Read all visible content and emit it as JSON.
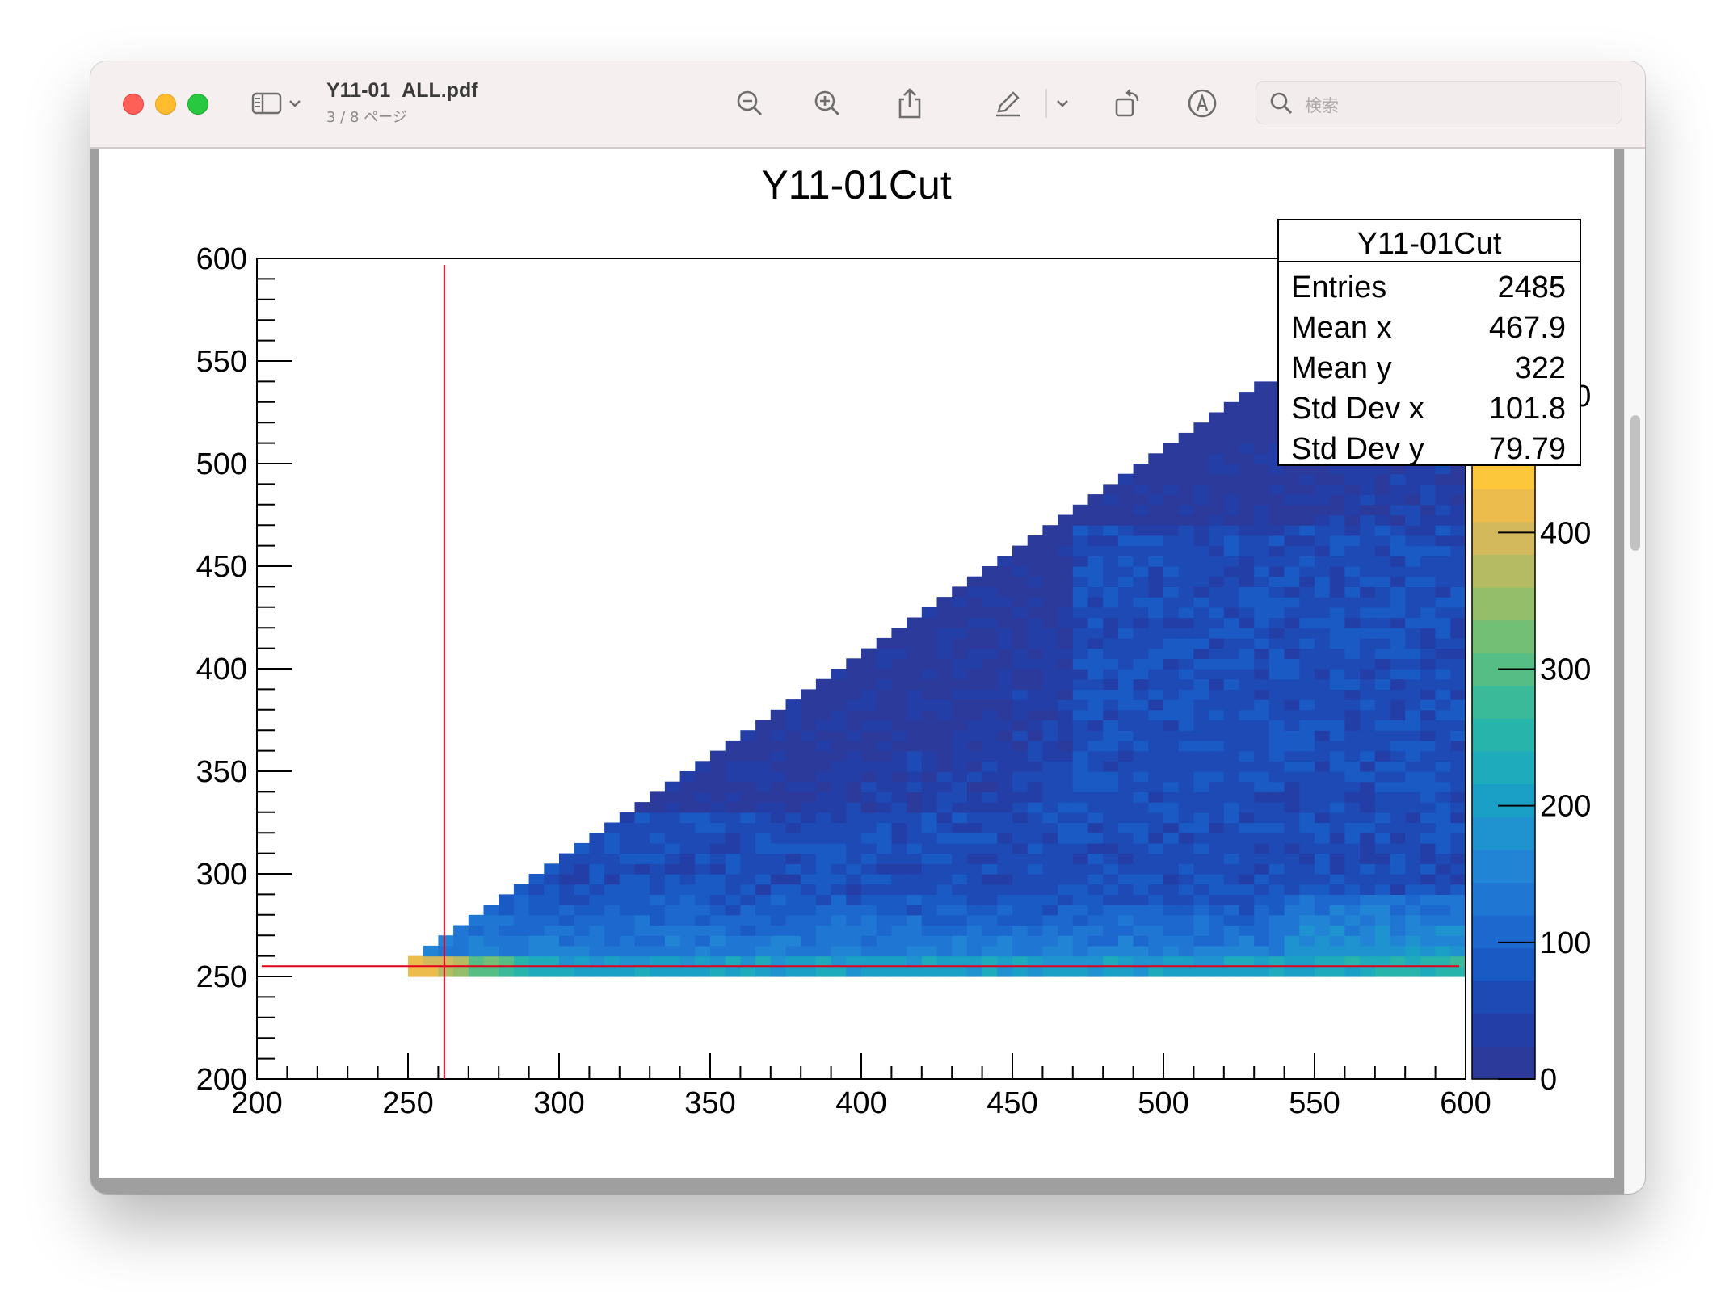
{
  "window": {
    "title": "Y11-01_ALL.pdf",
    "page_indicator": "3 / 8 ページ",
    "search_placeholder": "検索"
  },
  "toolbar": {
    "icons": [
      "sidebar-icon",
      "chevron-down-icon",
      "zoom-out-icon",
      "zoom-in-icon",
      "share-icon",
      "markup-pen-icon",
      "chevron-down-icon",
      "rotate-icon",
      "annotate-icon",
      "search-icon"
    ]
  },
  "chart_data": {
    "type": "heatmap",
    "title": "Y11-01Cut",
    "xlim": [
      200,
      600
    ],
    "ylim": [
      200,
      600
    ],
    "x_ticks": [
      200,
      250,
      300,
      350,
      400,
      450,
      500,
      550,
      600
    ],
    "y_ticks": [
      200,
      250,
      300,
      350,
      400,
      450,
      500,
      550,
      600
    ],
    "bin_width": 5,
    "z_range": [
      0,
      480
    ],
    "z_ticks": [
      0,
      100,
      200,
      300,
      400,
      500
    ],
    "z_tick_labels": [
      "0",
      "100",
      "200",
      "300",
      "400",
      "500"
    ],
    "palette": [
      "#2b3a9b",
      "#233fa7",
      "#1d4ab5",
      "#1a5ac5",
      "#1c68cf",
      "#2076d3",
      "#2284d4",
      "#1e93d0",
      "#1aa0c6",
      "#1eabbb",
      "#27b4ab",
      "#3bba9a",
      "#56be85",
      "#73bf75",
      "#95be6a",
      "#b5bb62",
      "#d4b85c",
      "#ecbd4d",
      "#fcc73b",
      "#fbd533"
    ],
    "region_description": "Filled region for y >= 250 and x >= y - 5 (approximately), x up to 600",
    "stats_box": {
      "title": "Y11-01Cut",
      "rows": [
        {
          "label": "Entries",
          "value": "2485"
        },
        {
          "label": "Mean x",
          "value": "467.9"
        },
        {
          "label": "Mean y",
          "value": "322"
        },
        {
          "label": "Std Dev x",
          "value": "101.8"
        },
        {
          "label": "Std Dev y",
          "value": "79.79"
        }
      ]
    },
    "cut_lines": {
      "vertical_x": 262,
      "horizontal_y": 255,
      "color": "#e4001b"
    }
  }
}
